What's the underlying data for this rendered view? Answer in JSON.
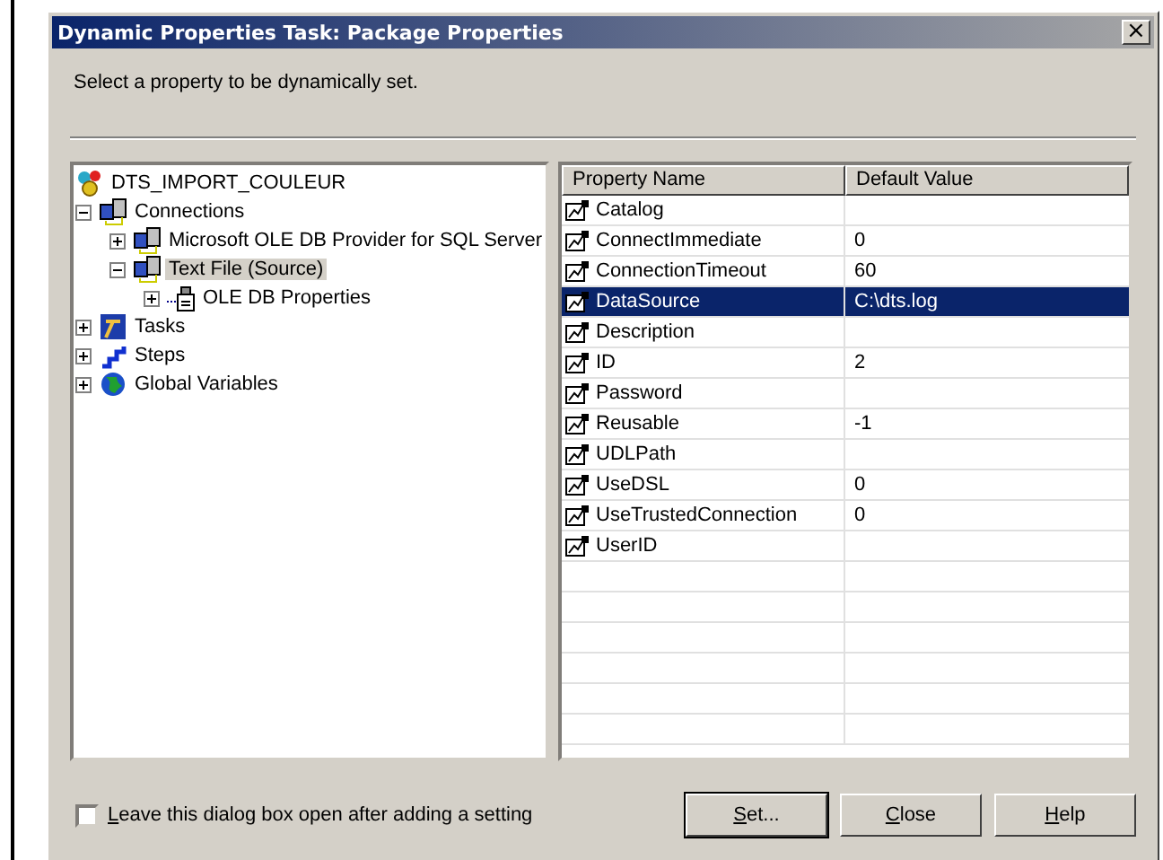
{
  "window": {
    "title": "Dynamic Properties Task: Package Properties",
    "close_glyph": "×"
  },
  "instruction": "Select a property to be dynamically set.",
  "tree": [
    {
      "label": "DTS_IMPORT_COULEUR",
      "kind": "package",
      "selected": false,
      "children": [
        {
          "label": "Connections",
          "kind": "connection",
          "expanded": true,
          "selected": false,
          "children": [
            {
              "label": "Microsoft OLE DB Provider for SQL Server",
              "kind": "connection",
              "expanded": false,
              "selected": false
            },
            {
              "label": "Text File (Source)",
              "kind": "connection",
              "expanded": true,
              "selected": true,
              "children": [
                {
                  "label": "OLE DB Properties",
                  "kind": "oledb",
                  "expanded": false,
                  "selected": false
                }
              ]
            }
          ]
        },
        {
          "label": "Tasks",
          "kind": "tasks",
          "expanded": false,
          "selected": false
        },
        {
          "label": "Steps",
          "kind": "steps",
          "expanded": false,
          "selected": false
        },
        {
          "label": "Global Variables",
          "kind": "globals",
          "expanded": false,
          "selected": false
        }
      ]
    }
  ],
  "table": {
    "columns": [
      "Property Name",
      "Default Value"
    ],
    "rows": [
      {
        "name": "Catalog",
        "value": "",
        "selected": false
      },
      {
        "name": "ConnectImmediate",
        "value": "0",
        "selected": false
      },
      {
        "name": "ConnectionTimeout",
        "value": "60",
        "selected": false
      },
      {
        "name": "DataSource",
        "value": "C:\\dts.log",
        "selected": true
      },
      {
        "name": "Description",
        "value": "",
        "selected": false
      },
      {
        "name": "ID",
        "value": "2",
        "selected": false
      },
      {
        "name": "Password",
        "value": "",
        "selected": false
      },
      {
        "name": "Reusable",
        "value": "-1",
        "selected": false
      },
      {
        "name": "UDLPath",
        "value": "",
        "selected": false
      },
      {
        "name": "UseDSL",
        "value": "0",
        "selected": false
      },
      {
        "name": "UseTrustedConnection",
        "value": "0",
        "selected": false
      },
      {
        "name": "UserID",
        "value": "",
        "selected": false
      }
    ]
  },
  "leave_open": {
    "label": "Leave this dialog box open after adding a setting",
    "checked": false
  },
  "buttons": [
    {
      "label": "Set...",
      "default": true
    },
    {
      "label": "Close",
      "default": false
    },
    {
      "label": "Help",
      "default": false
    }
  ]
}
